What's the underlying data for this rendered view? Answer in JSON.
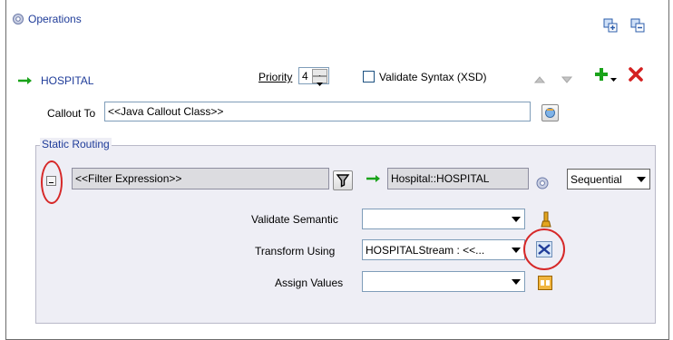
{
  "header": {
    "title": "Operations"
  },
  "operation": {
    "name": "HOSPITAL",
    "priority_label": "Priority",
    "priority_value": "4",
    "validate_syntax_label": "Validate Syntax (XSD)"
  },
  "callout": {
    "label": "Callout To",
    "value": "<<Java Callout Class>>"
  },
  "static_routing": {
    "legend": "Static Routing",
    "filter_expression": "<<Filter Expression>>",
    "target": "Hospital::HOSPITAL",
    "mode": "Sequential",
    "validate_semantic_label": "Validate Semantic",
    "validate_semantic_value": "",
    "transform_using_label": "Transform Using",
    "transform_using_value": "HOSPITALStream : <<...",
    "assign_values_label": "Assign Values",
    "assign_values_value": ""
  },
  "colors": {
    "accent_blue": "#1f3c99",
    "add_green": "#1aa31a",
    "delete_red": "#d42020",
    "highlight_red": "#d62828"
  }
}
